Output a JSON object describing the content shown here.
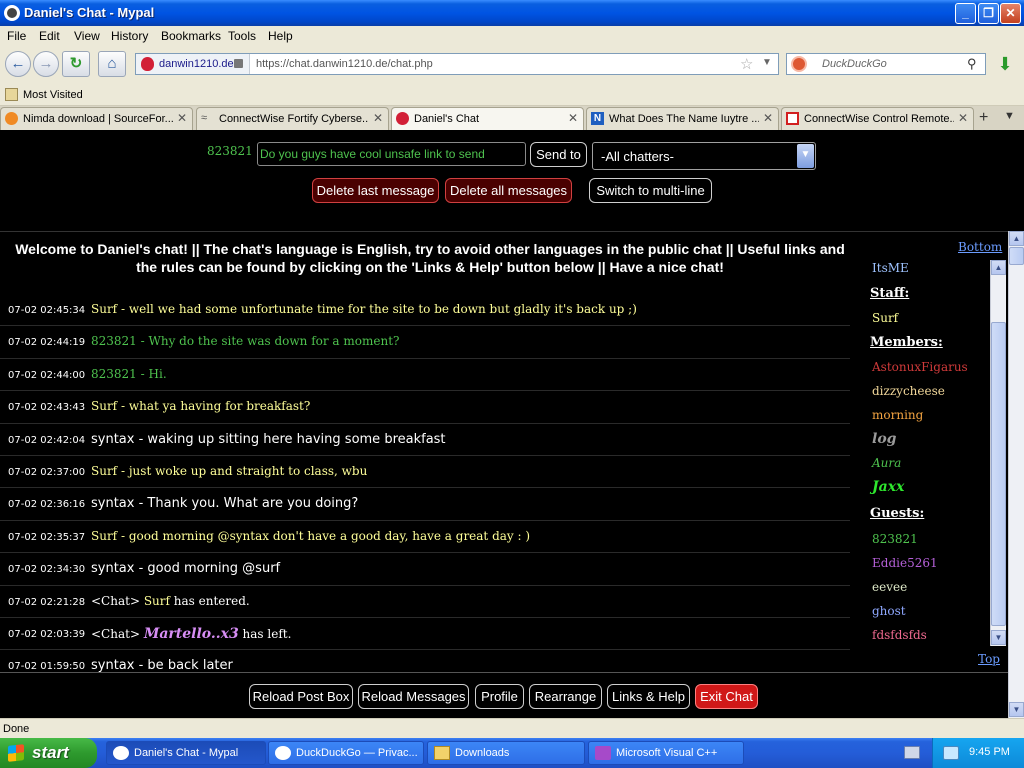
{
  "window": {
    "title": "Daniel's Chat - Mypal"
  },
  "menu": [
    "File",
    "Edit",
    "View",
    "History",
    "Bookmarks",
    "Tools",
    "Help"
  ],
  "addressbar": {
    "domain": "danwin1210.de",
    "url": "https://chat.danwin1210.de/chat.php"
  },
  "search": {
    "placeholder": "DuckDuckGo"
  },
  "bookmarks": {
    "most_visited": "Most Visited"
  },
  "tabs": [
    {
      "label": "Nimda download | SourceFor..."
    },
    {
      "label": "ConnectWise Fortify Cyberse..."
    },
    {
      "label": "Daniel's Chat"
    },
    {
      "label": "What Does The Name Iuytre ..."
    },
    {
      "label": "ConnectWise Control Remote..."
    }
  ],
  "poster": {
    "nickname": "823821",
    "message_value": "Do you guys have cool unsafe link to send",
    "send_label": "Send to",
    "recipient": "-All chatters-",
    "delete_last": "Delete last message",
    "delete_all": "Delete all messages",
    "multiline": "Switch to multi-line"
  },
  "chat": {
    "welcome": "Welcome to Daniel's chat! || The chat's language is English, try to avoid other languages in the public chat || Useful links and the rules can be found by clicking on the 'Links & Help' button below || Have a nice chat!",
    "messages": [
      {
        "time": "07-02 02:45:34",
        "sender": "Surf",
        "text": "- well we had some unfortunate time for the site to be down but gladly it's back up ;)"
      },
      {
        "time": "07-02 02:44:19",
        "sender": "823821",
        "text": "- Why do the site was down for a moment?"
      },
      {
        "time": "07-02 02:44:00",
        "sender": "823821",
        "text": "- Hi."
      },
      {
        "time": "07-02 02:43:43",
        "sender": "Surf",
        "text": "- what ya having for breakfast?"
      },
      {
        "time": "07-02 02:42:04",
        "sender": "syntax",
        "text": "- waking up sitting here having some breakfast"
      },
      {
        "time": "07-02 02:37:00",
        "sender": "Surf",
        "text": "- just woke up and straight to class, wbu"
      },
      {
        "time": "07-02 02:36:16",
        "sender": "syntax",
        "text": "- Thank you. What are you doing?"
      },
      {
        "time": "07-02 02:35:37",
        "sender": "Surf",
        "text": "- good morning @syntax don't have a good day, have a great day : )"
      },
      {
        "time": "07-02 02:34:30",
        "sender": "syntax",
        "text": "- good morning @surf"
      },
      {
        "time": "07-02 02:21:28",
        "sender": "<Chat>",
        "name": "Surf",
        "text": "has entered."
      },
      {
        "time": "07-02 02:03:39",
        "sender": "<Chat>",
        "name": "Martello..x3",
        "text": "has left."
      },
      {
        "time": "07-02 01:59:50",
        "sender": "syntax",
        "text": "- be back later"
      }
    ]
  },
  "sidebar": {
    "bottom_link": "Bottom",
    "top_link": "Top",
    "top_user": "ItsME",
    "staff_heading": "Staff:",
    "staff": [
      "Surf"
    ],
    "members_heading": "Members:",
    "members": [
      "AstonuxFigarus",
      "dizzycheese",
      "morning",
      "log",
      "Aura",
      "Jaxx"
    ],
    "guests_heading": "Guests:",
    "guests": [
      "823821",
      "Eddie5261",
      "eevee",
      "ghost",
      "fdsfdsfds"
    ]
  },
  "bottom_buttons": {
    "reload_post": "Reload Post Box",
    "reload_messages": "Reload Messages",
    "profile": "Profile",
    "rearrange": "Rearrange",
    "links_help": "Links & Help",
    "exit_chat": "Exit Chat"
  },
  "status": {
    "text": "Done"
  },
  "taskbar": {
    "start": "start",
    "tasks": [
      "Daniel's Chat - Mypal",
      "DuckDuckGo — Privac...",
      "Downloads",
      "Microsoft Visual C++"
    ],
    "clock": "9:45 PM"
  },
  "colors": {
    "chat_bg": "#000000",
    "surf_color": "#ffff99",
    "guest_green": "#4ec24e",
    "red_button": "#d01818",
    "xp_blue": "#0054e3"
  },
  "icons": [
    "back-arrow-icon",
    "forward-arrow-icon",
    "reload-icon",
    "home-icon",
    "lock-icon",
    "bookmark-star-icon",
    "search-icon",
    "download-arrow-icon",
    "windows-flag-icon"
  ]
}
